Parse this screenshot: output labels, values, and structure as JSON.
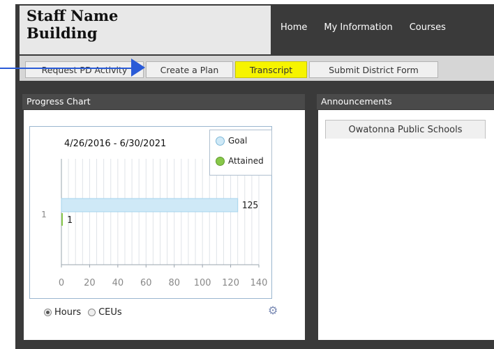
{
  "header": {
    "staff_name": "Staff Name",
    "building": "Building"
  },
  "nav": {
    "items": [
      "Home",
      "My Information",
      "Courses"
    ]
  },
  "toolbar": {
    "buttons": [
      {
        "label": "Request PD Activity",
        "active": false
      },
      {
        "label": "Create a Plan",
        "active": false
      },
      {
        "label": "Transcript",
        "active": true
      },
      {
        "label": "Submit District Form",
        "active": false
      }
    ]
  },
  "progress_panel": {
    "title": "Progress Chart"
  },
  "announcements_panel": {
    "title": "Announcements",
    "tab": "Owatonna Public Schools"
  },
  "radio": {
    "hours": "Hours",
    "ceus": "CEUs",
    "selected": "Hours"
  },
  "colors": {
    "goal": "#cfe9f7",
    "attained": "#88c84a",
    "active_button": "#f6f400",
    "arrow": "#2a5bd7"
  },
  "chart_data": {
    "type": "bar",
    "orientation": "horizontal",
    "title": "4/26/2016 - 6/30/2021",
    "categories": [
      "1"
    ],
    "series": [
      {
        "name": "Goal",
        "values": [
          125
        ]
      },
      {
        "name": "Attained",
        "values": [
          1
        ]
      }
    ],
    "xlim": [
      0,
      140
    ],
    "xticks": [
      "0",
      "20",
      "40",
      "60",
      "80",
      "100",
      "120",
      "140"
    ],
    "grid": true,
    "legend": "top-right"
  }
}
